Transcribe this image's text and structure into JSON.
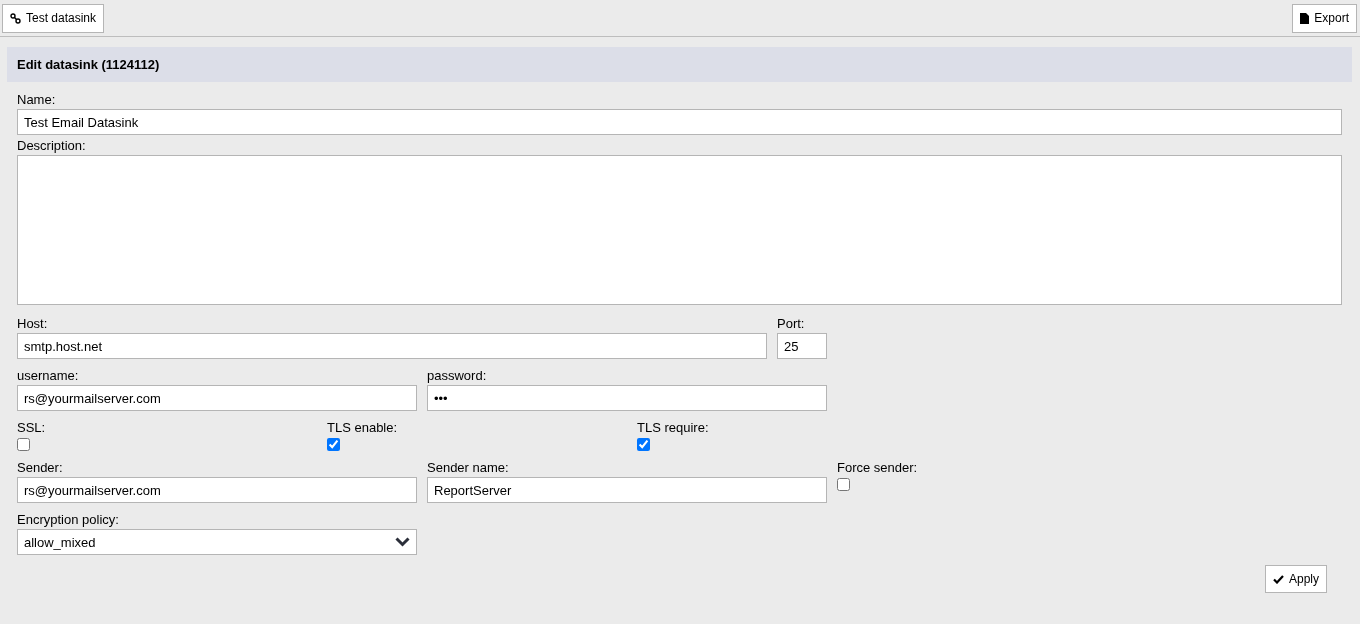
{
  "toolbar": {
    "left_button": "Test datasink",
    "right_button": "Export"
  },
  "panel": {
    "title": "Edit datasink (1124112)",
    "name": {
      "label": "Name:",
      "value": "Test Email Datasink"
    },
    "description": {
      "label": "Description:"
    },
    "host": {
      "label": "Host:",
      "value": "smtp.host.net"
    },
    "port": {
      "label": "Port:",
      "value": "25"
    },
    "username": {
      "label": "username:",
      "value": "rs@yourmailserver.com"
    },
    "password": {
      "label": "password:",
      "value": "•••"
    },
    "flags": [
      {
        "label": "SSL:",
        "checked": false
      },
      {
        "label": "TLS enable:",
        "checked": true
      },
      {
        "label": "TLS require:",
        "checked": true
      }
    ],
    "sender": {
      "label": "Sender:",
      "value": "rs@yourmailserver.com"
    },
    "sender_name": {
      "label": "Sender name:",
      "value": "ReportServer"
    },
    "force_sender": {
      "label": "Force sender:",
      "checked": false
    },
    "encryption_policy": {
      "label": "Encryption policy:",
      "value": "allow_mixed"
    },
    "apply_button": "Apply"
  }
}
